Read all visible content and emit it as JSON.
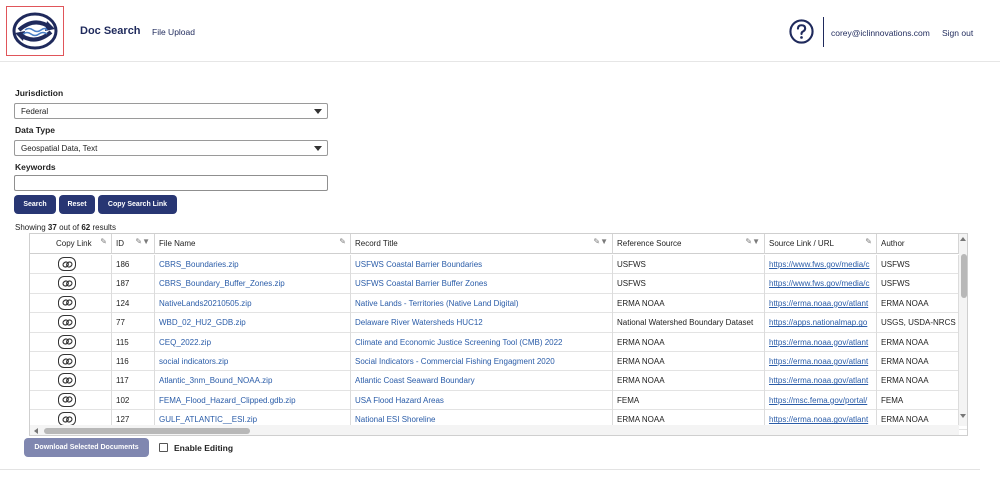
{
  "header": {
    "title": "Doc Search",
    "nav_upload": "File Upload",
    "user_email": "corey@iclinnovations.com",
    "sign_out": "Sign out",
    "brand_color": "#1f2a5c",
    "logo_icon": "circular-arrows-logo-icon",
    "help_icon": "question-circle-icon"
  },
  "form": {
    "jurisdiction_label": "Jurisdiction",
    "jurisdiction_value": "Federal",
    "datatype_label": "Data Type",
    "datatype_value": "Geospatial Data, Text",
    "keywords_label": "Keywords",
    "keywords_value": "",
    "search_label": "Search",
    "reset_label": "Reset",
    "copy_link_label": "Copy Search Link",
    "button_color": "#283673"
  },
  "results": {
    "prefix": "Showing",
    "shown": "37",
    "middle": "out of",
    "total": "62",
    "suffix": "results"
  },
  "grid": {
    "columns": [
      "Copy Link",
      "ID",
      "File Name",
      "Record Title",
      "Reference Source",
      "Source Link / URL",
      "Author"
    ],
    "rows": [
      {
        "id": "186",
        "file": "CBRS_Boundaries.zip",
        "title": "USFWS Coastal Barrier Boundaries",
        "source": "USFWS",
        "url": "https://www.fws.gov/media/c",
        "author": "USFWS"
      },
      {
        "id": "187",
        "file": "CBRS_Boundary_Buffer_Zones.zip",
        "title": "USFWS Coastal Barrier Buffer Zones",
        "source": "USFWS",
        "url": "https://www.fws.gov/media/c",
        "author": "USFWS"
      },
      {
        "id": "124",
        "file": "NativeLands20210505.zip",
        "title": "Native Lands - Territories (Native Land Digital)",
        "source": "ERMA NOAA",
        "url": "https://erma.noaa.gov/atlant",
        "author": "ERMA NOAA"
      },
      {
        "id": "77",
        "file": "WBD_02_HU2_GDB.zip",
        "title": "Delaware River Watersheds HUC12",
        "source": "National Watershed Boundary Dataset",
        "url": "https://apps.nationalmap.go",
        "author": "USGS, USDA-NRCS"
      },
      {
        "id": "115",
        "file": "CEQ_2022.zip",
        "title": "Climate and Economic Justice Screening Tool (CMB) 2022",
        "source": "ERMA NOAA",
        "url": "https://erma.noaa.gov/atlant",
        "author": "ERMA NOAA"
      },
      {
        "id": "116",
        "file": "social indicators.zip",
        "title": "Social Indicators - Commercial Fishing Engagment 2020",
        "source": "ERMA NOAA",
        "url": "https://erma.noaa.gov/atlant",
        "author": "ERMA NOAA"
      },
      {
        "id": "117",
        "file": "Atlantic_3nm_Bound_NOAA.zip",
        "title": "Atlantic Coast Seaward Boundary",
        "source": "ERMA NOAA",
        "url": "https://erma.noaa.gov/atlant",
        "author": "ERMA NOAA"
      },
      {
        "id": "102",
        "file": "FEMA_Flood_Hazard_Clipped.gdb.zip",
        "title": "USA Flood Hazard Areas",
        "source": "FEMA",
        "url": "https://msc.fema.gov/portal/",
        "author": "FEMA"
      },
      {
        "id": "127",
        "file": "GULF_ATLANTIC__ESI.zip",
        "title": "National ESI Shoreline",
        "source": "ERMA NOAA",
        "url": "https://erma.noaa.gov/atlant",
        "author": "ERMA NOAA"
      }
    ]
  },
  "footer": {
    "download_label": "Download Selected Documents",
    "enable_editing_label": "Enable Editing",
    "enable_editing_checked": false
  }
}
